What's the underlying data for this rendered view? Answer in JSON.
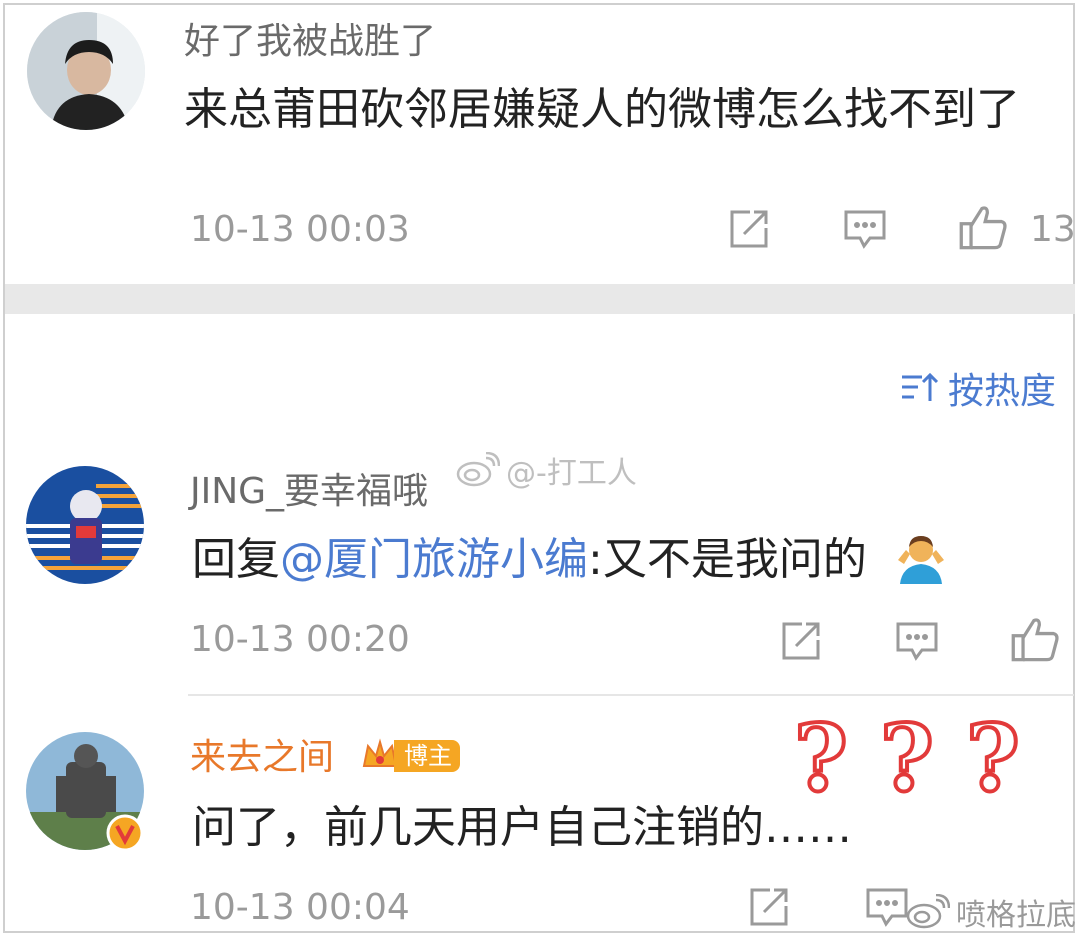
{
  "comments": [
    {
      "user": "好了我被战胜了",
      "text": "来总莆田砍邻居嫌疑人的微博怎么找不到了",
      "time": "10-13 00:03",
      "likes": "13"
    },
    {
      "user": "JING_要幸福哦",
      "reply_prefix": "回复",
      "mention": "@厦门旅游小编",
      "reply_body": ":又不是我问的",
      "time": "10-13 00:20"
    },
    {
      "user": "来去之间",
      "badge": "博主",
      "text": "问了，前几天用户自己注销的……",
      "time": "10-13 00:04"
    }
  ],
  "sort_label": "按热度",
  "watermarks": [
    "@-打工人",
    "喷格拉底"
  ],
  "colors": {
    "accent_blue": "#4b7bd0",
    "orange_name": "#e8782a",
    "question_red": "#e23a3a"
  },
  "icons": [
    "repost-icon",
    "comment-icon",
    "like-icon",
    "sort-icon",
    "weibo-logo-icon",
    "verified-icon",
    "crown-icon"
  ]
}
